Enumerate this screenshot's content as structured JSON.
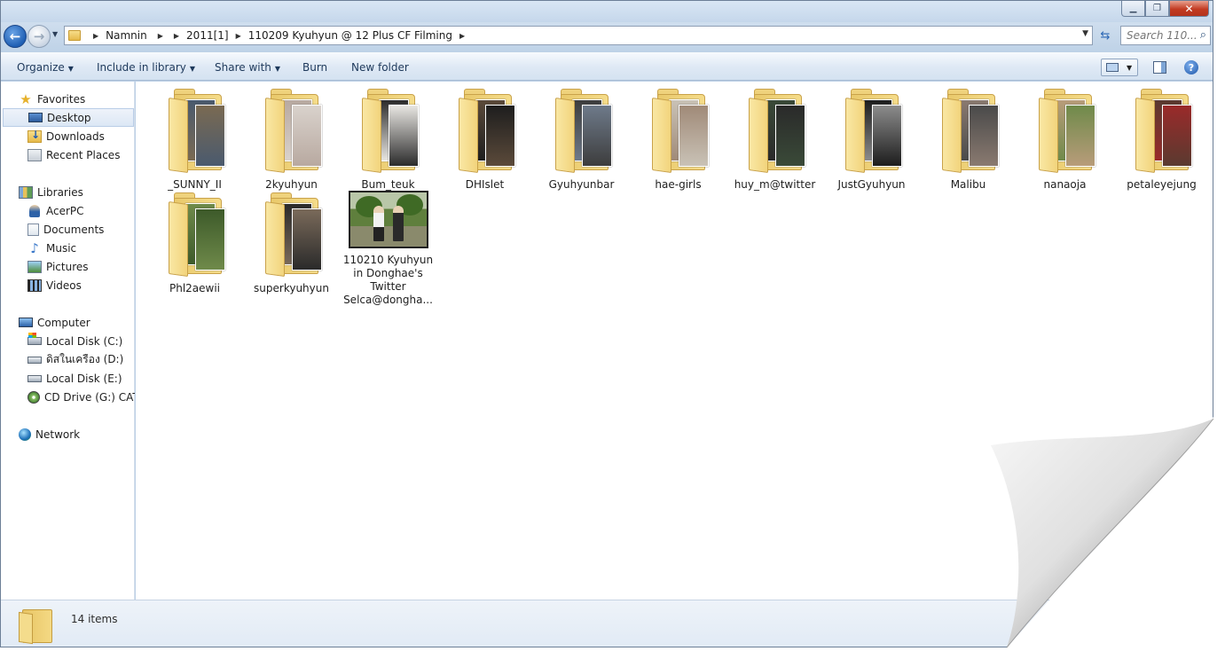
{
  "window": {
    "caption_buttons": {
      "minimize_icon": "minimize-icon",
      "maximize_icon": "maximize-icon",
      "close_icon": "close-icon"
    }
  },
  "address": {
    "breadcrumbs": [
      "Namnin",
      "2011[1]",
      "110209 Kyuhyun @ 12 Plus CF Filming"
    ],
    "search_placeholder": "Search 110..."
  },
  "toolbar": {
    "organize": "Organize",
    "include_in_library": "Include in library",
    "share_with": "Share with",
    "burn": "Burn",
    "new_folder": "New folder"
  },
  "sidebar": {
    "favorites": {
      "label": "Favorites",
      "items": [
        "Desktop",
        "Downloads",
        "Recent Places"
      ]
    },
    "libraries": {
      "label": "Libraries",
      "items": [
        "AcerPC",
        "Documents",
        "Music",
        "Pictures",
        "Videos"
      ]
    },
    "computer": {
      "label": "Computer",
      "items": [
        "Local Disk (C:)",
        "ดิสในเครือง (D:)",
        "Local Disk (E:)",
        "CD Drive (G:) CAT ("
      ]
    },
    "network": {
      "label": "Network"
    }
  },
  "items": [
    {
      "name": "_SUNNY_II",
      "type": "folder",
      "colors": [
        "#4a5a6e",
        "#7a6a52"
      ]
    },
    {
      "name": "2kyuhyun",
      "type": "folder",
      "colors": [
        "#b8a9a0",
        "#d9d2cc"
      ]
    },
    {
      "name": "Bum_teuk",
      "type": "folder",
      "colors": [
        "#2b2b2b",
        "#e8e6e2"
      ]
    },
    {
      "name": "DHIslet",
      "type": "folder",
      "colors": [
        "#5b4a3a",
        "#1e1e1e"
      ]
    },
    {
      "name": "Gyuhyunbar",
      "type": "folder",
      "colors": [
        "#3d3d3d",
        "#6e7a8a"
      ]
    },
    {
      "name": "hae-girls",
      "type": "folder",
      "colors": [
        "#c9c2b6",
        "#a08a78"
      ]
    },
    {
      "name": "huy_m@twitter",
      "type": "folder",
      "colors": [
        "#3a4a38",
        "#2a2a2a"
      ]
    },
    {
      "name": "JustGyuhyun",
      "type": "folder",
      "colors": [
        "#1d1d1d",
        "#8c8c8c"
      ]
    },
    {
      "name": "Malibu",
      "type": "folder",
      "colors": [
        "#8a7a70",
        "#4a4a4a"
      ]
    },
    {
      "name": "nanaoja",
      "type": "folder",
      "colors": [
        "#b89c7a",
        "#6f8a4a"
      ]
    },
    {
      "name": "petaleyejung",
      "type": "folder",
      "colors": [
        "#5a3a30",
        "#9a2a2a"
      ]
    },
    {
      "name": "Phl2aewii",
      "type": "folder",
      "colors": [
        "#6f8a4a",
        "#3d5a2a"
      ]
    },
    {
      "name": "superkyuhyun",
      "type": "folder",
      "colors": [
        "#2a2a2a",
        "#7a6a5a"
      ]
    },
    {
      "name": "110210 Kyuhyun in Donghae's Twitter Selca@dongha...",
      "type": "image"
    }
  ],
  "details": {
    "count": "14 items"
  }
}
